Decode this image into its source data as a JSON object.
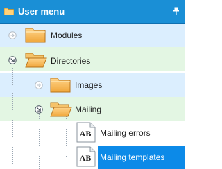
{
  "header": {
    "title": "User menu",
    "pin_icon": "pin-icon"
  },
  "tree": {
    "items": [
      {
        "label": "Modules",
        "icon": "folder-icon",
        "state": "collapsed"
      },
      {
        "label": "Directories",
        "icon": "folder-open-icon",
        "state": "expanded"
      },
      {
        "label": "Images",
        "icon": "folder-icon",
        "state": "collapsed"
      },
      {
        "label": "Mailing",
        "icon": "folder-open-icon",
        "state": "expanded"
      },
      {
        "label": "Mailing errors",
        "icon": "report-ab-icon",
        "state": "leaf"
      },
      {
        "label": "Mailing templates",
        "icon": "report-ab-icon",
        "state": "leaf",
        "selected": true
      }
    ]
  },
  "colors": {
    "header_bg": "#1a8fd6",
    "row_blue": "#dbeefe",
    "row_green": "#e3f6e3",
    "selection": "#0c8ae8"
  }
}
